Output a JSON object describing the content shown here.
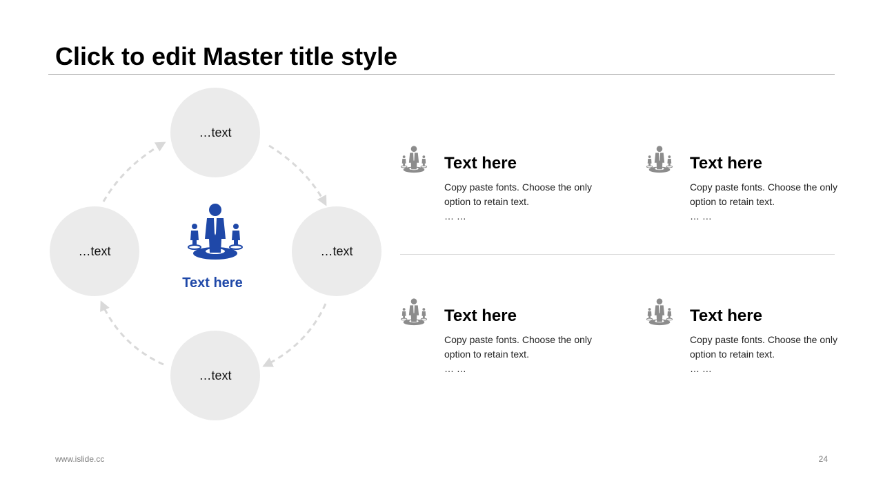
{
  "slide": {
    "title": "Click to edit Master title style",
    "footer_url": "www.islide.cc",
    "page_number": "24"
  },
  "cycle": {
    "nodes": [
      {
        "label": "…text"
      },
      {
        "label": "…text"
      },
      {
        "label": "…text"
      },
      {
        "label": "…text"
      }
    ],
    "center_label": "Text here",
    "center_icon": "team-people-icon"
  },
  "items": [
    {
      "title": "Text here",
      "body": "Copy paste fonts. Choose the only option to retain text.",
      "ellipsis": "… …",
      "icon": "team-people-icon"
    },
    {
      "title": "Text here",
      "body": "Copy paste fonts. Choose the only option to retain text.",
      "ellipsis": "… …",
      "icon": "team-people-icon"
    },
    {
      "title": "Text here",
      "body": "Copy paste fonts. Choose the only option to retain text.",
      "ellipsis": "… …",
      "icon": "team-people-icon"
    },
    {
      "title": "Text here",
      "body": "Copy paste fonts. Choose the only option to retain text.",
      "ellipsis": "… …",
      "icon": "team-people-icon"
    }
  ],
  "colors": {
    "accent": "#1f48a8",
    "icon_gray": "#8c8c8c",
    "circle_fill": "#ebebeb",
    "arrow": "#d9d9d9"
  }
}
